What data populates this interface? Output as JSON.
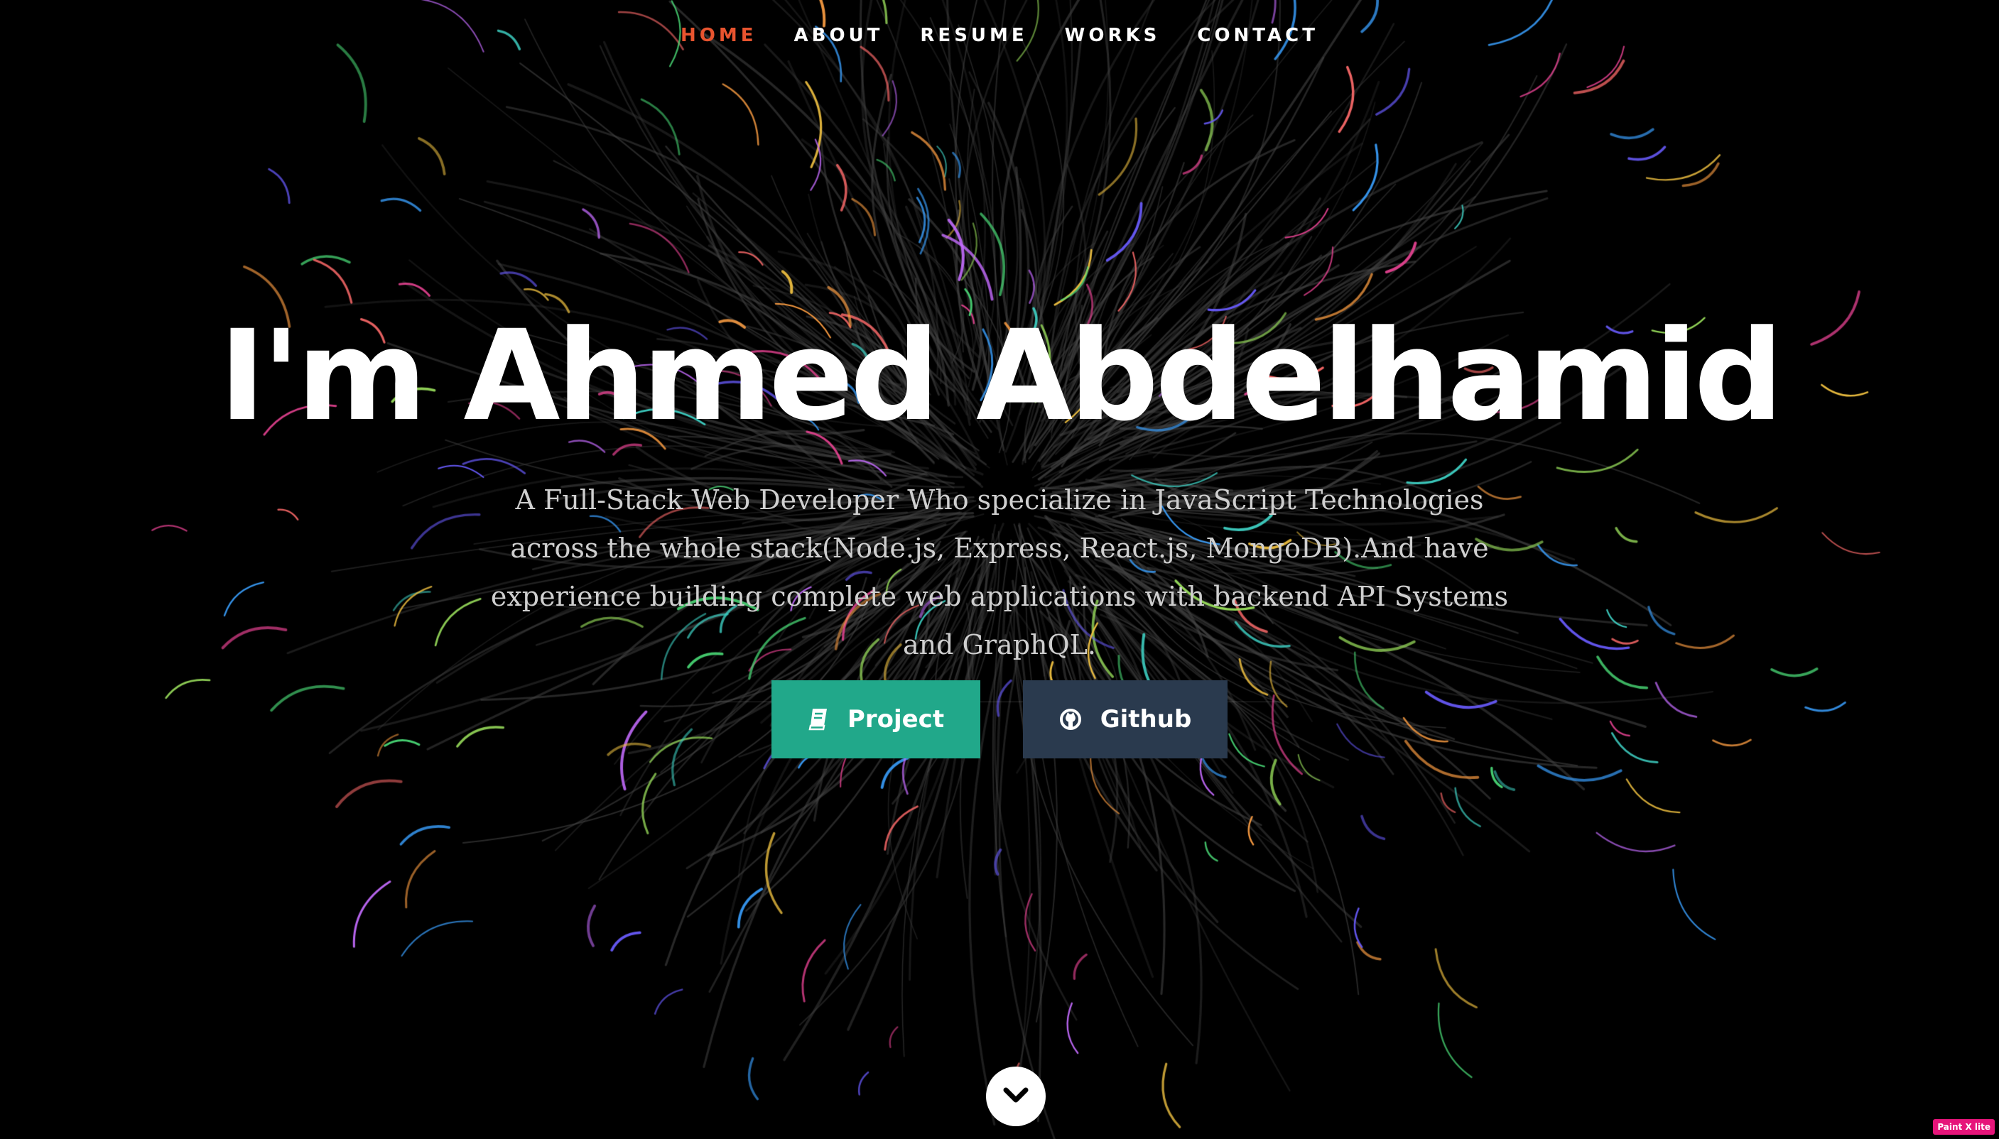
{
  "nav": {
    "items": [
      {
        "label": "HOME",
        "active": true
      },
      {
        "label": "ABOUT",
        "active": false
      },
      {
        "label": "RESUME",
        "active": false
      },
      {
        "label": "WORKS",
        "active": false
      },
      {
        "label": "CONTACT",
        "active": false
      }
    ]
  },
  "hero": {
    "title": "I'm Ahmed Abdelhamid",
    "description": "A Full-Stack Web Developer Who specialize in JavaScript Technologies across the whole stack(Node.js, Express, React.js, MongoDB).And have experience building complete web applications with backend API Systems and GraphQL."
  },
  "buttons": {
    "project": {
      "label": "Project",
      "icon": "book-icon"
    },
    "github": {
      "label": "Github",
      "icon": "github-icon"
    }
  },
  "scroll": {
    "icon": "chevron-down-icon"
  },
  "badge": {
    "label": "Paint X lite"
  },
  "colors": {
    "background": "#000000",
    "nav_active": "#e8542f",
    "project_button": "#21a88a",
    "github_button": "#2a3a4e",
    "text": "#ffffff",
    "subtext": "#cfcfcf"
  }
}
